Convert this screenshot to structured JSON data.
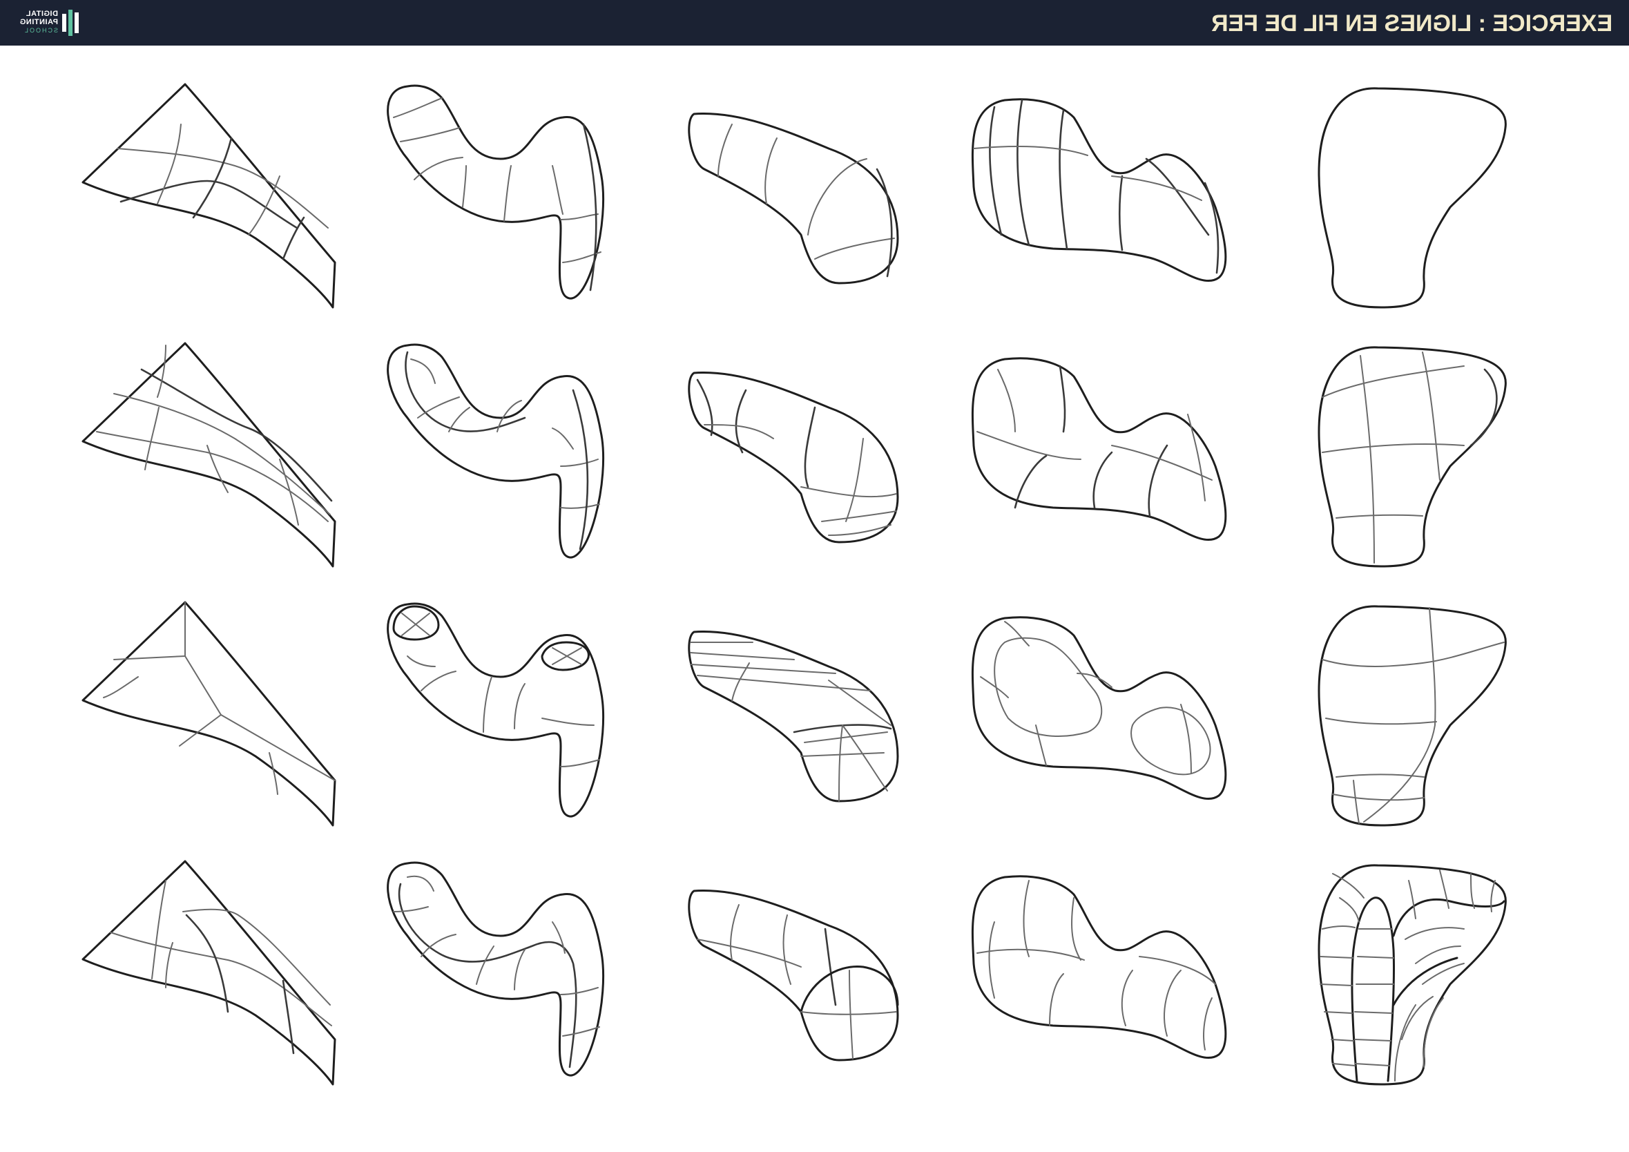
{
  "header": {
    "title": "EXERCICE : LIGNES EN FIL DE FER",
    "logo": {
      "line1": "DIGITAL",
      "line2": "PAINTING",
      "line3": "SCHOOL",
      "icon": "brush-logo-icon"
    },
    "colors": {
      "bar": "#1b2233",
      "title": "#f1e9c8",
      "accent": "#5fc2a0"
    }
  }
}
